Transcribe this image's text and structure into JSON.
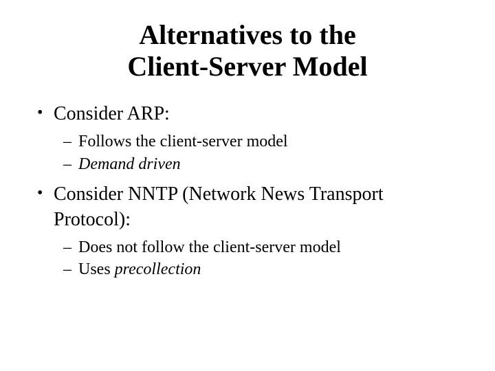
{
  "title_line1": "Alternatives to the",
  "title_line2": "Client-Server Model",
  "bullets": [
    {
      "text": "Consider ARP:",
      "sub": [
        {
          "plain": "Follows the client-server model"
        },
        {
          "italic": "Demand driven"
        }
      ]
    },
    {
      "text": "Consider NNTP (Network News Transport Protocol):",
      "sub": [
        {
          "plain": "Does not follow the client-server model"
        },
        {
          "mixed_prefix": "Uses ",
          "mixed_italic": "precollection"
        }
      ]
    }
  ]
}
